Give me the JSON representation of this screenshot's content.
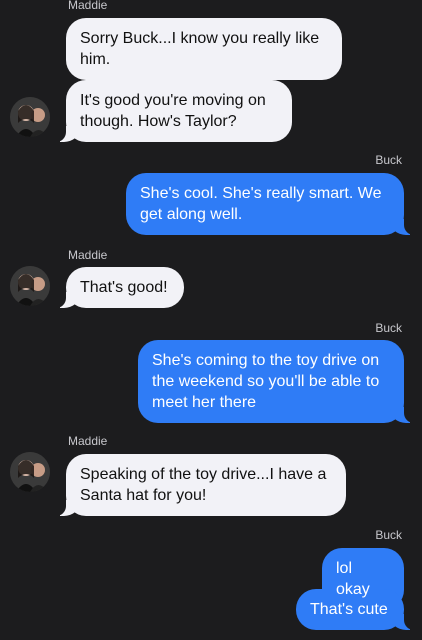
{
  "thread": {
    "messages": [
      {
        "sender": "Maddie",
        "direction": "incoming",
        "text": "Sorry Buck...I know you really like him."
      },
      {
        "sender": "Maddie",
        "direction": "incoming",
        "text": "It's good you're moving on though. How's Taylor?"
      },
      {
        "sender": "Buck",
        "direction": "outgoing",
        "text": "She's cool. She's really smart. We get along well."
      },
      {
        "sender": "Maddie",
        "direction": "incoming",
        "text": "That's good!"
      },
      {
        "sender": "Buck",
        "direction": "outgoing",
        "text": "She's coming to the toy drive on the weekend so you'll be able to meet her there"
      },
      {
        "sender": "Maddie",
        "direction": "incoming",
        "text": "Speaking of the toy drive...I have a Santa hat for you!"
      },
      {
        "sender": "Buck",
        "direction": "outgoing",
        "text": "lol okay"
      },
      {
        "sender": "Buck",
        "direction": "outgoing",
        "text": "That's cute"
      }
    ]
  },
  "colors": {
    "background": "#1c1c1e",
    "incoming_bubble": "#f2f2f7",
    "outgoing_bubble": "#2f7cf6"
  }
}
